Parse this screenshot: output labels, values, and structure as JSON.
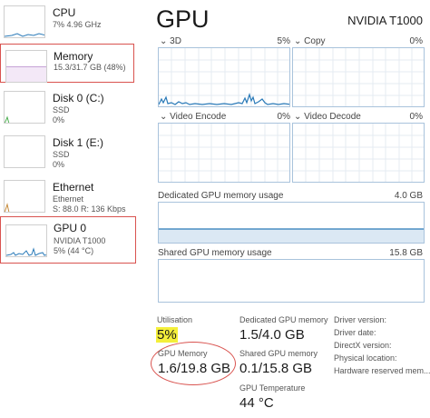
{
  "sidebar": {
    "items": [
      {
        "title": "CPU",
        "lines": [
          "7%  4.96 GHz"
        ]
      },
      {
        "title": "Memory",
        "lines": [
          "15.3/31.7 GB (48%)"
        ]
      },
      {
        "title": "Disk 0 (C:)",
        "lines": [
          "SSD",
          "0%"
        ]
      },
      {
        "title": "Disk 1 (E:)",
        "lines": [
          "SSD",
          "0%"
        ]
      },
      {
        "title": "Ethernet",
        "lines": [
          "Ethernet",
          "S: 88.0  R: 136 Kbps"
        ]
      },
      {
        "title": "GPU 0",
        "lines": [
          "NVIDIA T1000",
          "5% (44 °C)"
        ]
      }
    ]
  },
  "header": {
    "title": "GPU",
    "device": "NVIDIA T1000"
  },
  "graphs": {
    "engine_3d": {
      "label": "3D",
      "value": "5%"
    },
    "copy": {
      "label": "Copy",
      "value": "0%"
    },
    "video_encode": {
      "label": "Video Encode",
      "value": "0%"
    },
    "video_decode": {
      "label": "Video Decode",
      "value": "0%"
    },
    "dedicated": {
      "label": "Dedicated GPU memory usage",
      "value": "4.0 GB"
    },
    "shared": {
      "label": "Shared GPU memory usage",
      "value": "15.8 GB"
    }
  },
  "stats": {
    "utilisation": {
      "label": "Utilisation",
      "value": "5%"
    },
    "dedicated": {
      "label": "Dedicated GPU memory",
      "value": "1.5/4.0 GB"
    },
    "gpu_memory": {
      "label": "GPU Memory",
      "value": "1.6/19.8 GB"
    },
    "shared": {
      "label": "Shared GPU memory",
      "value": "0.1/15.8 GB"
    },
    "temperature": {
      "label": "GPU Temperature",
      "value": "44 °C"
    }
  },
  "properties": [
    "Driver version:",
    "Driver date:",
    "DirectX version:",
    "Physical location:",
    "Hardware reserved mem..."
  ],
  "colors": {
    "memory_line": "#8e44ad",
    "disk_line": "#4caf50",
    "ethernet_line": "#c58a3a",
    "gpu_line": "#2a7ab8",
    "selected_border": "#d9534f",
    "highlight": "#f4ef3a"
  }
}
